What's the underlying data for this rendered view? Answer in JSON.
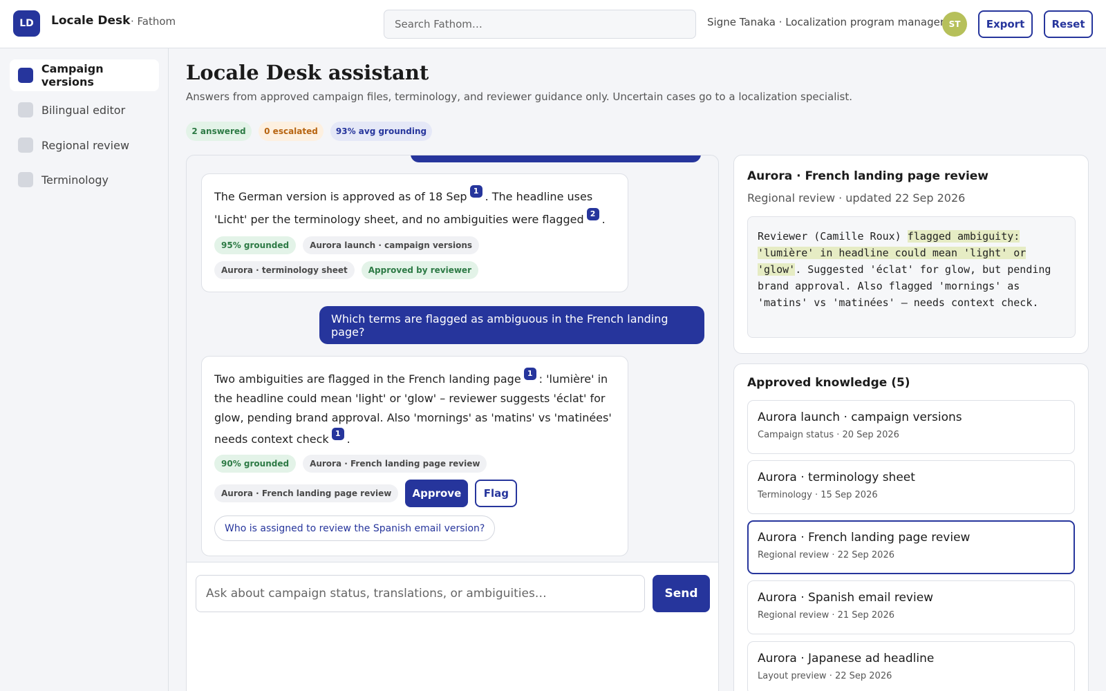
{
  "header": {
    "logo_text": "LD",
    "app_name": "Locale Desk",
    "org_name": "· Fathom",
    "search_placeholder": "Search Fathom…",
    "user": "Signe Tanaka · Localization program manager",
    "avatar": "ST",
    "export_label": "Export",
    "reset_label": "Reset"
  },
  "sidebar": {
    "items": [
      {
        "label": "Campaign versions",
        "active": true
      },
      {
        "label": "Bilingual editor",
        "active": false
      },
      {
        "label": "Regional review",
        "active": false
      },
      {
        "label": "Terminology",
        "active": false
      }
    ]
  },
  "main": {
    "title": "Locale Desk assistant",
    "subtitle": "Answers from approved campaign files, terminology, and reviewer guidance only. Uncertain cases go to a localization specialist.",
    "stats": {
      "answered": "2 answered",
      "escalated": "0 escalated",
      "grounding": "93% avg grounding"
    }
  },
  "chat": {
    "answer1": {
      "t1": "The German version is approved as of 18 Sep",
      "c1": "1",
      "t2": ". The headline uses 'Licht' per the terminology sheet, and no ambiguities were flagged",
      "c2": "2",
      "t3": ".",
      "grounded": "95% grounded",
      "source1": "Aurora launch · campaign versions",
      "source2": "Aurora · terminology sheet",
      "status": "Approved by reviewer"
    },
    "question": "Which terms are flagged as ambiguous in the French landing page?",
    "answer2": {
      "t1": "Two ambiguities are flagged in the French landing page",
      "c1": "1",
      "t2": ": 'lumière' in the headline could mean 'light' or 'glow' – reviewer suggests 'éclat' for glow, pending brand approval. Also 'mornings' as 'matins' vs 'matinées' needs context check",
      "c2": "1",
      "t3": ".",
      "grounded": "90% grounded",
      "source1": "Aurora · French landing page review",
      "source2": "Aurora · French landing page review",
      "approve_label": "Approve",
      "flag_label": "Flag",
      "suggestion": "Who is assigned to review the Spanish email version?"
    },
    "composer_placeholder": "Ask about campaign status, translations, or ambiguities…",
    "send_label": "Send"
  },
  "detail": {
    "title": "Aurora · French landing page review",
    "meta": "Regional review · updated 22 Sep 2026",
    "excerpt_prefix": "Reviewer (Camille Roux) ",
    "excerpt_highlight": "flagged ambiguity: 'lumière' in headline could mean 'light' or 'glow'",
    "excerpt_suffix": ". Suggested 'éclat' for glow, but pending brand approval. Also flagged 'mornings' as 'matins' vs 'matinées' — needs context check."
  },
  "knowledge": {
    "title": "Approved knowledge (5)",
    "items": [
      {
        "title": "Aurora launch · campaign versions",
        "meta": "Campaign status · 20 Sep 2026",
        "selected": false
      },
      {
        "title": "Aurora · terminology sheet",
        "meta": "Terminology · 15 Sep 2026",
        "selected": false
      },
      {
        "title": "Aurora · French landing page review",
        "meta": "Regional review · 22 Sep 2026",
        "selected": true
      },
      {
        "title": "Aurora · Spanish email review",
        "meta": "Regional review · 21 Sep 2026",
        "selected": false
      },
      {
        "title": "Aurora · Japanese ad headline",
        "meta": "Layout preview · 22 Sep 2026",
        "selected": false
      }
    ]
  },
  "colors": {
    "accent": "#26359c",
    "grounded_bg": "#e3f3e8",
    "escalated_bg": "#fdf0e0",
    "highlight": "#e6ecc4"
  }
}
